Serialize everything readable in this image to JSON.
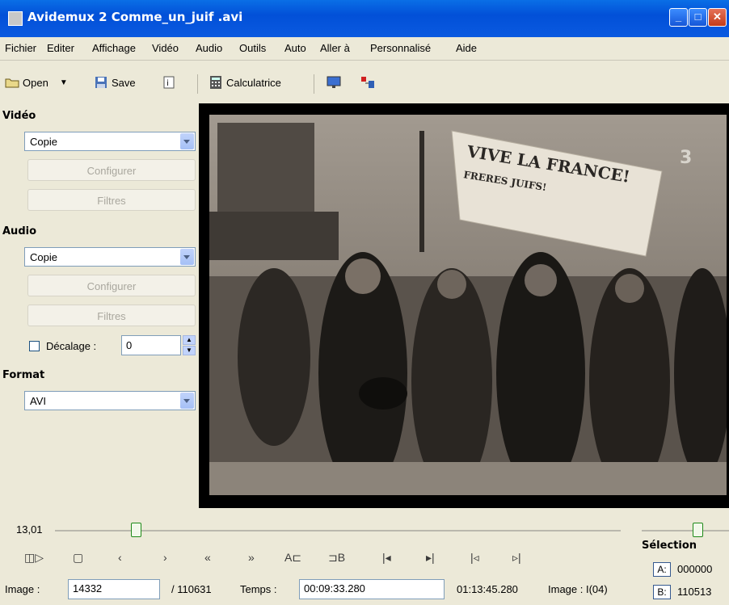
{
  "window": {
    "title": "Avidemux 2 Comme_un_juif .avi"
  },
  "menu": [
    "Fichier",
    "Editer",
    "Affichage",
    "Vidéo",
    "Audio",
    "Outils",
    "Auto",
    "Aller à",
    "Personnalisé",
    "Aide"
  ],
  "toolbar": {
    "open": "Open",
    "save": "Save",
    "calculator": "Calculatrice"
  },
  "video": {
    "section": "Vidéo",
    "codec": "Copie",
    "configure": "Configurer",
    "filters": "Filtres"
  },
  "audio": {
    "section": "Audio",
    "codec": "Copie",
    "configure": "Configurer",
    "filters": "Filtres",
    "shift_label": "Décalage :",
    "shift_value": "0"
  },
  "format": {
    "section": "Format",
    "value": "AVI"
  },
  "banner": {
    "line1": "VIVE LA FRANCE!",
    "line2": "FRERES JUIFS!",
    "channel": "3"
  },
  "slider": {
    "label": "13,01"
  },
  "selection": {
    "title": "Sélection",
    "a_label": "A:",
    "a_value": "000000",
    "b_label": "B:",
    "b_value": "110513"
  },
  "status": {
    "image_label": "Image :",
    "image_value": "14332",
    "total": "/ 110631",
    "time_label": "Temps :",
    "time_value": "00:09:33.280",
    "duration": "01:13:45.280",
    "frame_type": "Image : I(04)"
  },
  "transport": [
    "play",
    "stop",
    "prev-frame",
    "next-frame",
    "rewind",
    "fast-forward",
    "mark-a",
    "mark-b",
    "go-start",
    "go-end",
    "prev-keyframe",
    "next-keyframe"
  ],
  "transport_labels": {
    "mark_a": "A",
    "mark_b": "B"
  }
}
